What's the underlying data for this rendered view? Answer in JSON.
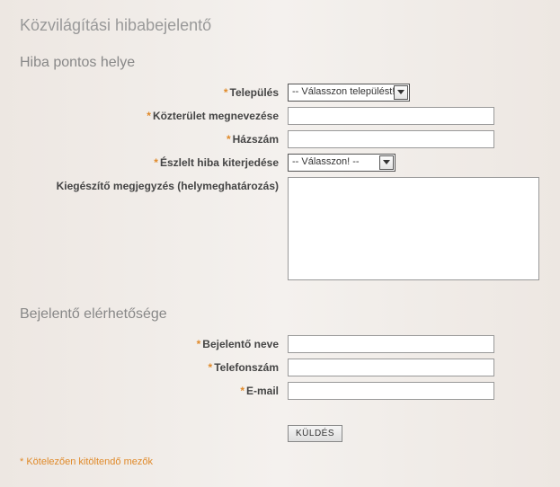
{
  "title": "Közvilágítási hibabejelentő",
  "section1": {
    "heading": "Hiba pontos helye",
    "fields": {
      "settlement_label": "Település",
      "settlement_selected": "-- Válasszon települést! --",
      "street_label": "Közterület megnevezése",
      "house_label": "Házszám",
      "extent_label": "Észlelt hiba kiterjedése",
      "extent_selected": "-- Válasszon! --",
      "note_label": "Kiegészítő megjegyzés (helymeghatározás)"
    }
  },
  "section2": {
    "heading": "Bejelentő elérhetősége",
    "fields": {
      "name_label": "Bejelentő neve",
      "phone_label": "Telefonszám",
      "email_label": "E-mail"
    }
  },
  "submit_label": "KÜLDÉS",
  "required_note": "* Kötelezően kitöltendő mezők"
}
